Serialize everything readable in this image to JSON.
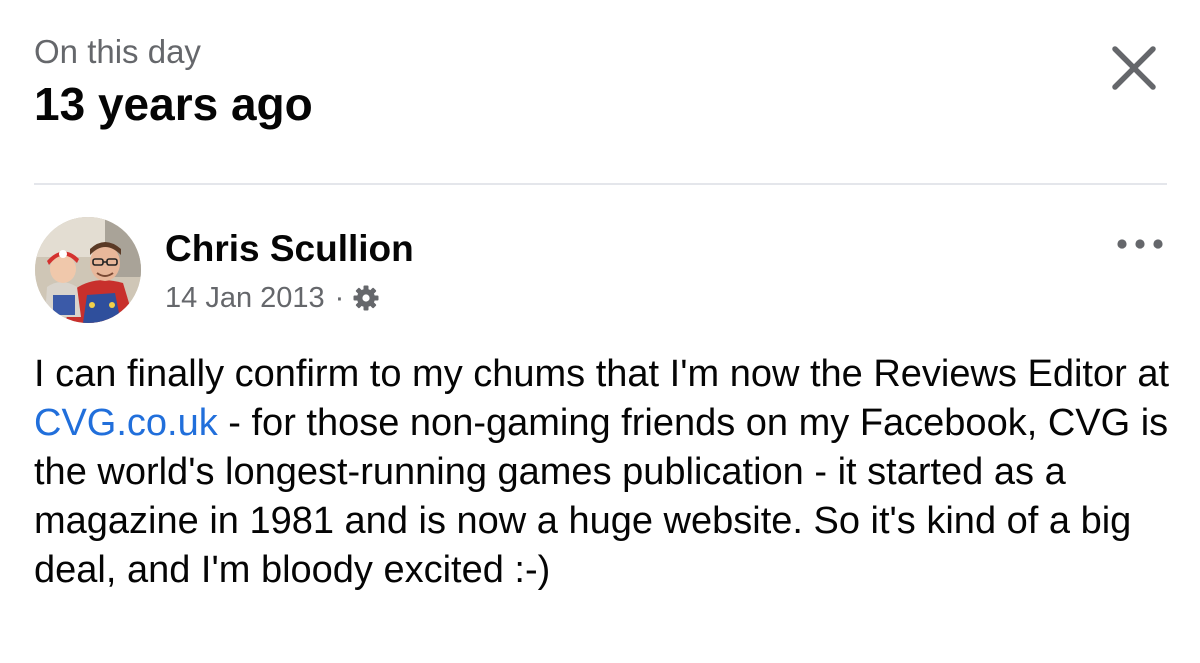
{
  "header": {
    "subtitle": "On this day",
    "title": "13 years ago",
    "close_icon": "close-icon"
  },
  "post": {
    "author": "Chris Scullion",
    "date": "14 Jan 2013",
    "separator": "·",
    "privacy_icon": "gear-icon",
    "more_icon": "more-horizontal-icon",
    "text_before_link": "I can finally confirm to my chums that I'm now the Reviews Editor at ",
    "link_text": "CVG.co.uk",
    "text_after_link": " - for those non-gaming friends on my Facebook, CVG is the world's longest-running games publication - it started as a magazine in 1981 and is now a huge website. So it's kind of a big deal, and I'm bloody excited :-)"
  },
  "colors": {
    "text": "#050505",
    "secondary": "#65676b",
    "link": "#216fdb",
    "divider": "#e4e6eb"
  }
}
